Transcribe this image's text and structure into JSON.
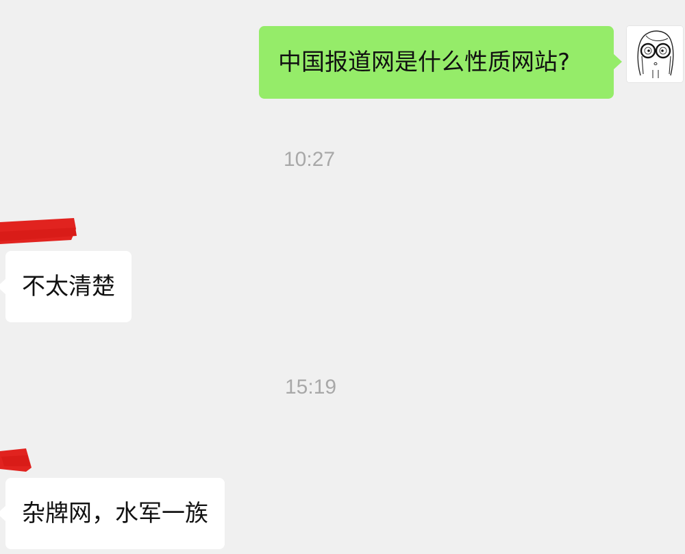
{
  "messages": [
    {
      "sender": "me",
      "text": "中国报道网是什么性质网站?"
    },
    {
      "type": "timestamp",
      "text": "10:27"
    },
    {
      "sender": "other",
      "text": "不太清楚"
    },
    {
      "type": "timestamp",
      "text": "15:19"
    },
    {
      "sender": "other",
      "text": "杂牌网，水军一族"
    }
  ],
  "colors": {
    "background": "#f0f0f0",
    "outgoing_bubble": "#95ec69",
    "incoming_bubble": "#ffffff",
    "timestamp": "#a8a8a8",
    "redaction": "#e1231f"
  },
  "icons": {
    "my_avatar": "sketch-girl-with-glasses-avatar"
  }
}
